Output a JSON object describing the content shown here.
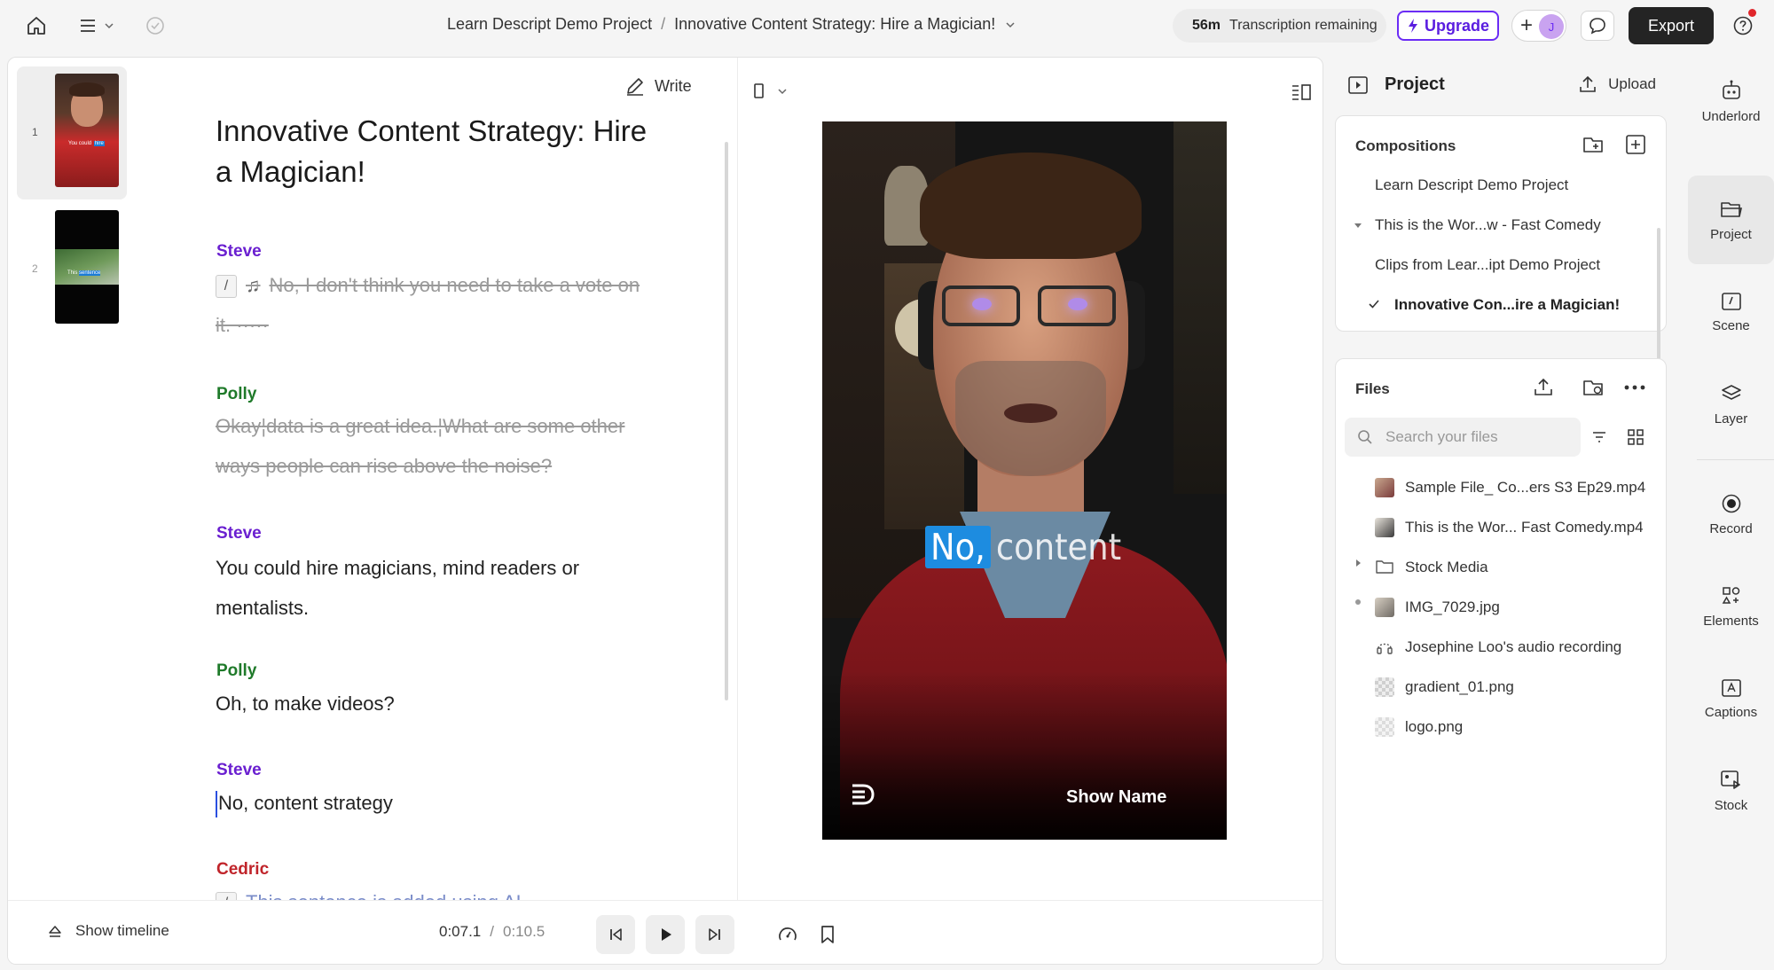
{
  "topbar": {
    "breadcrumb_project": "Learn Descript Demo Project",
    "breadcrumb_sep": "/",
    "breadcrumb_comp": "Innovative Content Strategy: Hire a Magician!",
    "transcription_minutes": "56m",
    "transcription_label": "Transcription remaining",
    "upgrade_label": "Upgrade",
    "avatar_initial": "J",
    "export_label": "Export"
  },
  "scenes": [
    {
      "number": "1",
      "caption_a": "You could ",
      "caption_b": "hire"
    },
    {
      "number": "2",
      "caption_a": "This ",
      "caption_b": "sentence"
    }
  ],
  "script": {
    "write_label": "Write",
    "title": "Innovative Content Strategy: Hire a Magician!",
    "blocks": [
      {
        "speaker": "Steve",
        "slash": "/",
        "music": "♫",
        "text": "No, I don't think you need to take a vote on it. ·····"
      },
      {
        "speaker": "Polly",
        "text_a": "Okay",
        "text_b": "data is a great idea.",
        "text_c": "What are some other ways people can rise above the noise?"
      },
      {
        "speaker": "Steve",
        "text": "You could hire magicians, mind readers or mentalists."
      },
      {
        "speaker": "Polly",
        "text": "Oh, to make videos?"
      },
      {
        "speaker": "Steve",
        "text": "No, content strategy"
      },
      {
        "speaker": "Cedric",
        "slash": "/",
        "text": "This sentence is added using AI"
      }
    ]
  },
  "preview": {
    "caption_highlight": "No,",
    "caption_rest": "content",
    "show_name": "Show Name"
  },
  "playback": {
    "show_timeline_label": "Show timeline",
    "current_time": "0:07.1",
    "time_sep": "/",
    "total_time": "0:10.5"
  },
  "project_panel": {
    "title": "Project",
    "upload_label": "Upload",
    "compositions_label": "Compositions",
    "compositions": [
      "Learn Descript Demo Project",
      "This is the Wor...w - Fast Comedy",
      "Clips from Lear...ipt Demo Project",
      "Innovative Con...ire a Magician!"
    ],
    "files_label": "Files",
    "search_placeholder": "Search your files",
    "files": [
      "Sample File_ Co...ers S3 Ep29.mp4",
      "This is the Wor... Fast Comedy.mp4",
      "Stock Media",
      "IMG_7029.jpg",
      "Josephine Loo's audio recording",
      "gradient_01.png",
      "logo.png"
    ]
  },
  "rail": {
    "items": [
      "Underlord",
      "Project",
      "Scene",
      "Layer",
      "Record",
      "Elements",
      "Captions",
      "Stock"
    ]
  },
  "colors": {
    "accent": "#6b2cf5",
    "steve": "#6a1fd0",
    "polly": "#1f7a2a",
    "cedric": "#c0242a",
    "caption_highlight": "#1d8ce0"
  }
}
